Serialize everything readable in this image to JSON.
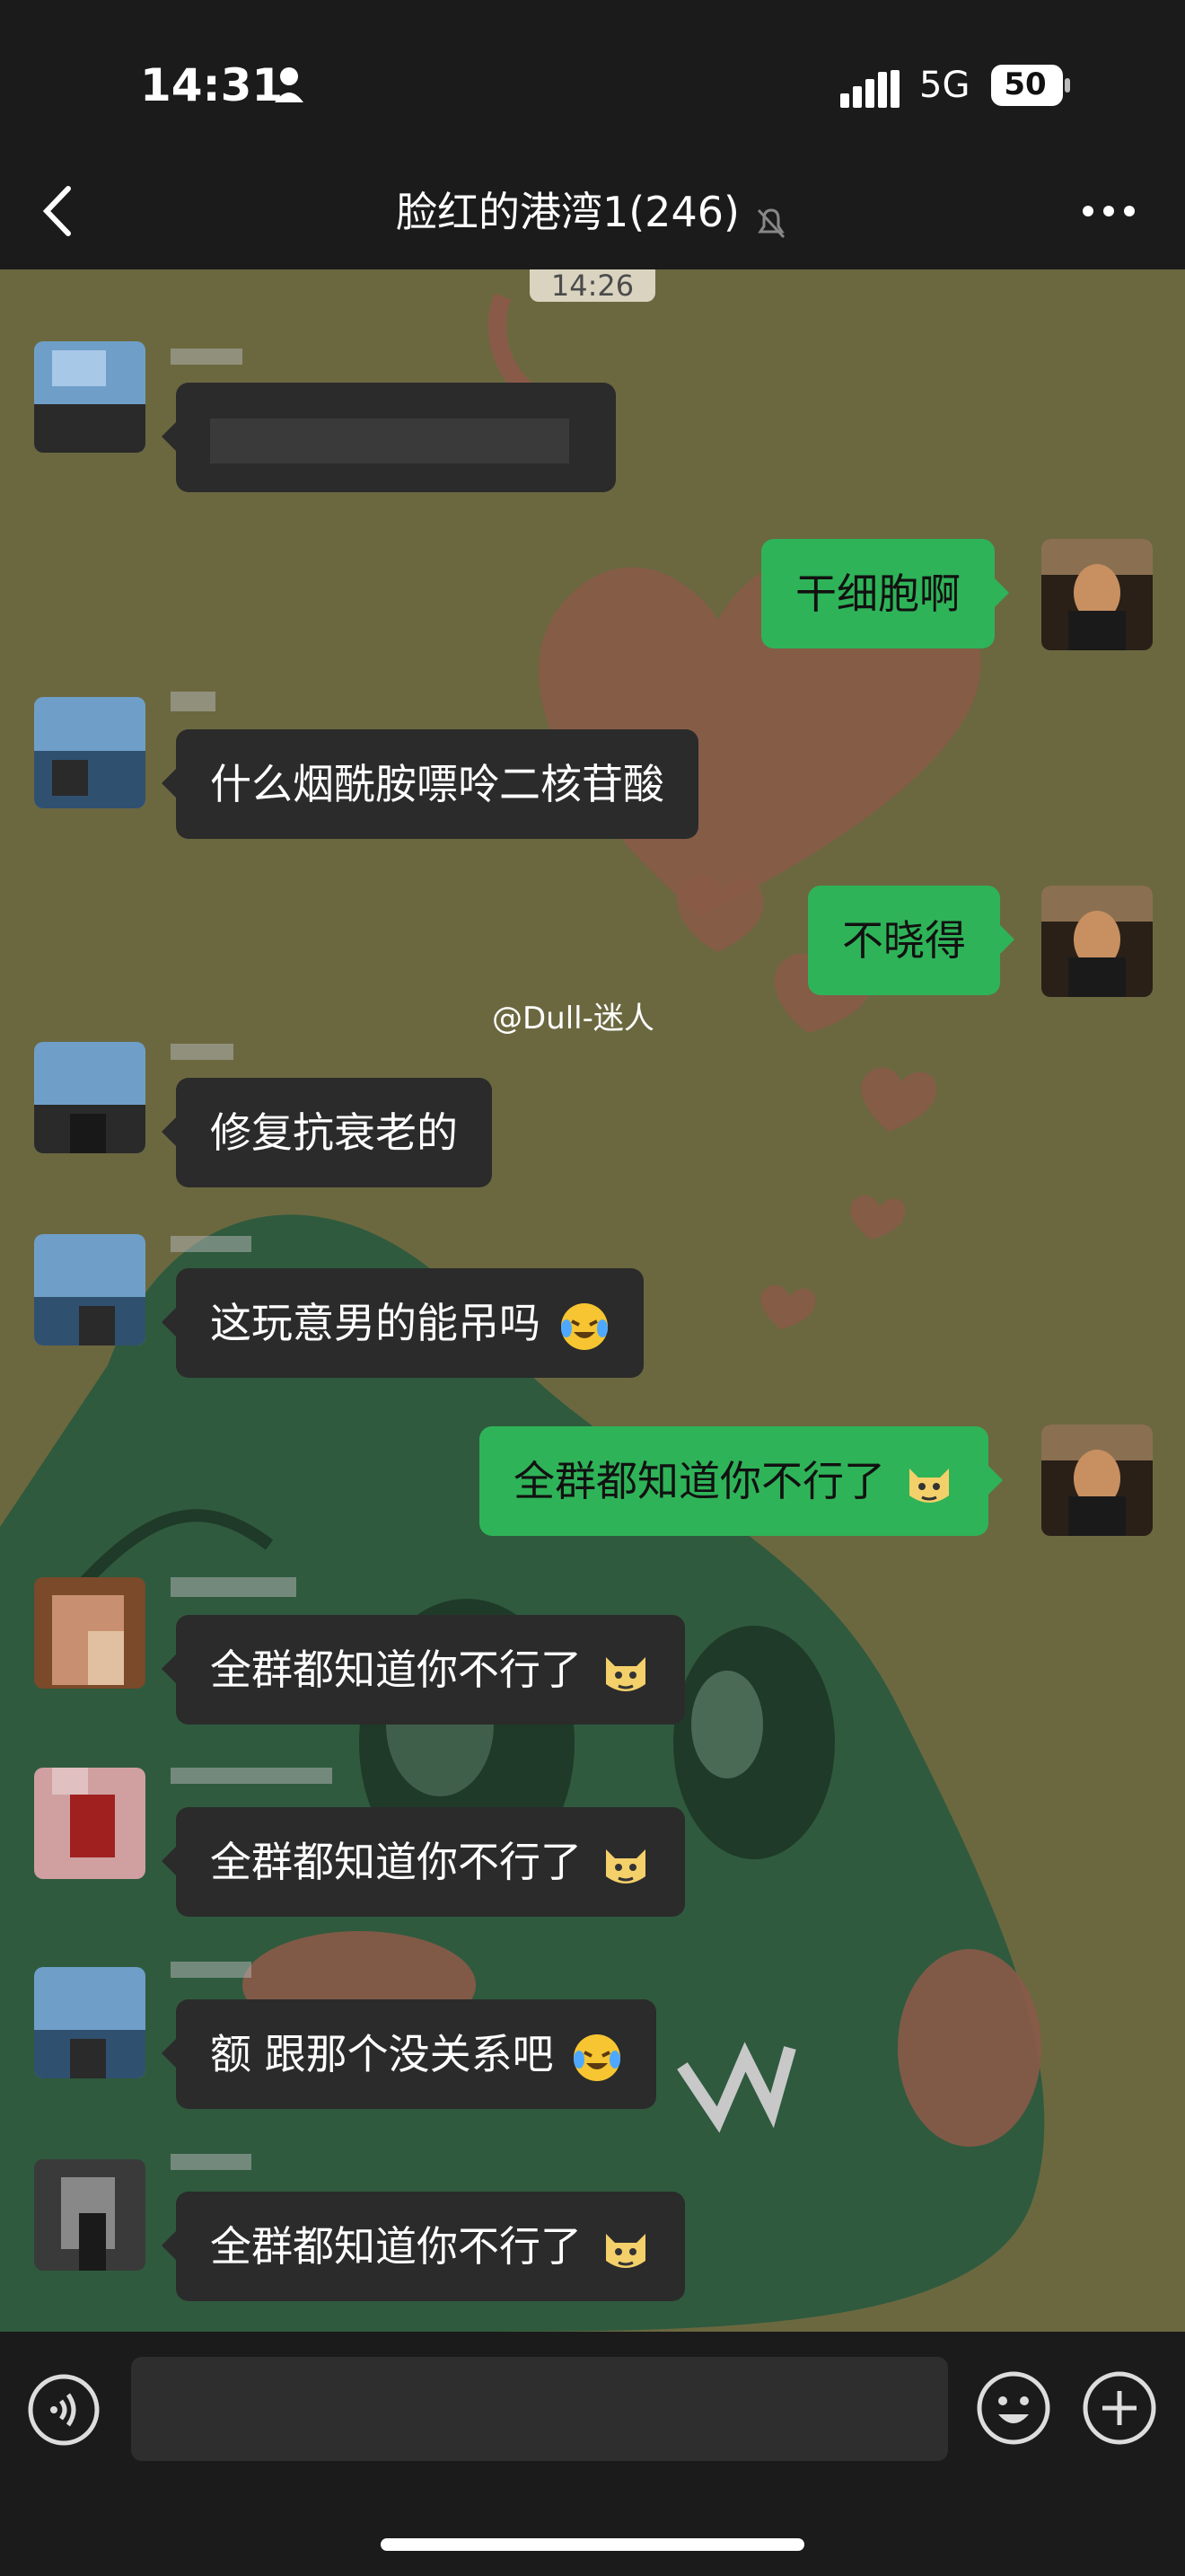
{
  "status_bar": {
    "time": "14:31",
    "network": "5G",
    "battery": "50"
  },
  "header": {
    "title": "脸红的港湾1(246)"
  },
  "chat": {
    "timestamp": "14:26",
    "watermark": "@Dull-迷人",
    "messages": [
      {
        "side": "left",
        "text": ""
      },
      {
        "side": "right",
        "text": "干细胞啊"
      },
      {
        "side": "left",
        "text": "什么烟酰胺嘌呤二核苷酸"
      },
      {
        "side": "right",
        "text": "不晓得"
      },
      {
        "side": "left",
        "text": "修复抗衰老的"
      },
      {
        "side": "left",
        "text": "这玩意男的能吊吗",
        "emoji": "laugh-cry-emoji"
      },
      {
        "side": "right",
        "text": "全群都知道你不行了",
        "emoji": "smug-cat-emoji"
      },
      {
        "side": "left",
        "text": "全群都知道你不行了",
        "emoji": "smug-cat-emoji"
      },
      {
        "side": "left",
        "text": "全群都知道你不行了",
        "emoji": "smug-cat-emoji"
      },
      {
        "side": "left",
        "text": "额 跟那个没关系吧",
        "emoji": "laugh-cry-emoji"
      },
      {
        "side": "left",
        "text": "全群都知道你不行了",
        "emoji": "smug-cat-emoji"
      }
    ]
  },
  "colors": {
    "header_bg": "#1b1b1b",
    "left_bubble": "#2b2b2b",
    "right_bubble": "#2fb358",
    "chat_bg": "#6b6840"
  }
}
